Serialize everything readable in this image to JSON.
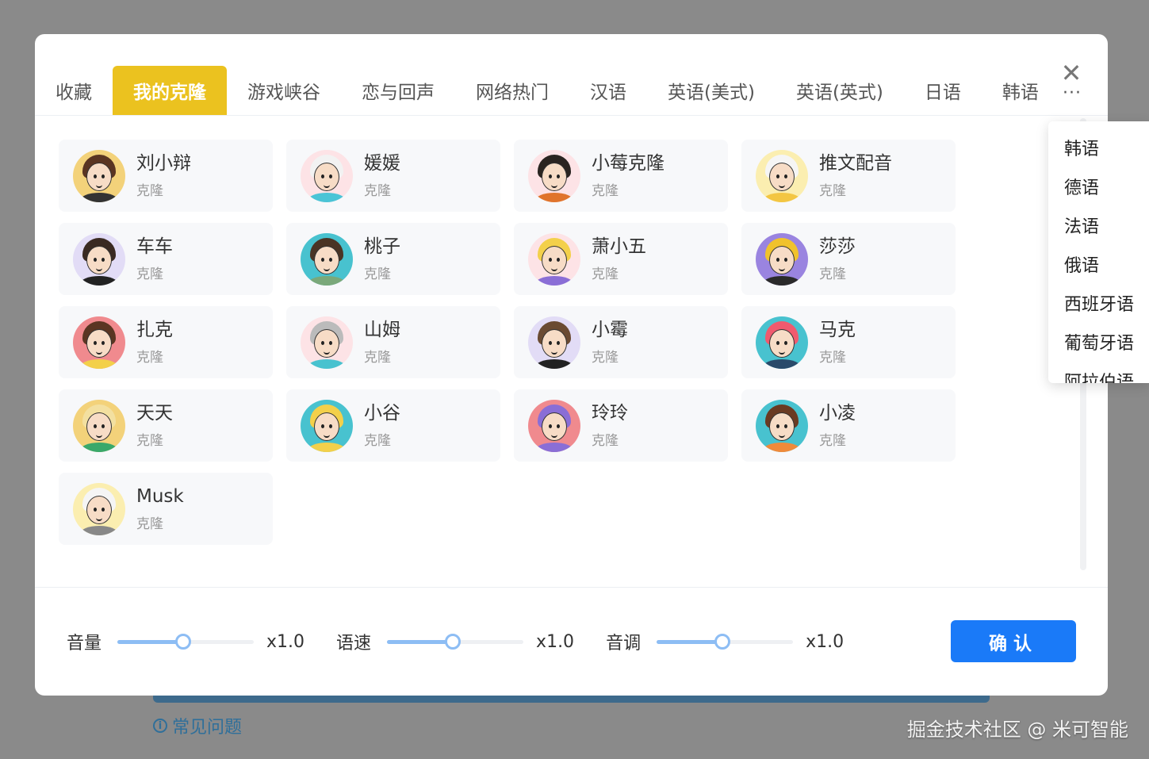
{
  "background": {
    "faq_label": "常见问题",
    "faq_icon": "info-circle-icon",
    "watermark": "掘金技术社区 @ 米可智能"
  },
  "tabs": [
    {
      "label": "收藏",
      "active": false
    },
    {
      "label": "我的克隆",
      "active": true
    },
    {
      "label": "游戏峡谷",
      "active": false
    },
    {
      "label": "恋与回声",
      "active": false
    },
    {
      "label": "网络热门",
      "active": false
    },
    {
      "label": "汉语",
      "active": false
    },
    {
      "label": "英语(美式)",
      "active": false
    },
    {
      "label": "英语(英式)",
      "active": false
    },
    {
      "label": "日语",
      "active": false
    },
    {
      "label": "韩语",
      "active": false
    }
  ],
  "close_icon": "close-icon",
  "more_label": "···",
  "voices": [
    {
      "name": "刘小辩",
      "sub": "克隆",
      "bg": "#f3d27a",
      "hair": "#5a3522",
      "body": "#333333"
    },
    {
      "name": "媛媛",
      "sub": "克隆",
      "bg": "#fde3e6",
      "hair": "#f2f2f2",
      "body": "#4bc4d6"
    },
    {
      "name": "小莓克隆",
      "sub": "克隆",
      "bg": "#fde3e6",
      "hair": "#2a2420",
      "body": "#e0742c"
    },
    {
      "name": "推文配音",
      "sub": "克隆",
      "bg": "#fbeeb0",
      "hair": "#f5f5f5",
      "body": "#f3c643"
    },
    {
      "name": "车车",
      "sub": "克隆",
      "bg": "#e2dcf6",
      "hair": "#3a2a22",
      "body": "#222222"
    },
    {
      "name": "桃子",
      "sub": "克隆",
      "bg": "#48c2cf",
      "hair": "#4a3424",
      "body": "#7aa87a"
    },
    {
      "name": "萧小五",
      "sub": "克隆",
      "bg": "#fde3e6",
      "hair": "#f3d04a",
      "body": "#8a6ed6"
    },
    {
      "name": "莎莎",
      "sub": "克隆",
      "bg": "#9a84e0",
      "hair": "#f0c22c",
      "body": "#2a2a2a"
    },
    {
      "name": "扎克",
      "sub": "克隆",
      "bg": "#f08a8e",
      "hair": "#5a3522",
      "body": "#f3d04a"
    },
    {
      "name": "山姆",
      "sub": "克隆",
      "bg": "#fde3e6",
      "hair": "#bbbbbb",
      "body": "#48c2cf"
    },
    {
      "name": "小霉",
      "sub": "克隆",
      "bg": "#e2dcf6",
      "hair": "#6a4a32",
      "body": "#222222"
    },
    {
      "name": "马克",
      "sub": "克隆",
      "bg": "#48c2cf",
      "hair": "#f05a6e",
      "body": "#2a4a6a"
    },
    {
      "name": "天天",
      "sub": "克隆",
      "bg": "#f3d27a",
      "hair": "#f3e0a0",
      "body": "#3aa86a"
    },
    {
      "name": "小谷",
      "sub": "克隆",
      "bg": "#48c2cf",
      "hair": "#f3d04a",
      "body": "#f3d04a"
    },
    {
      "name": "玲玲",
      "sub": "克隆",
      "bg": "#f08a8e",
      "hair": "#8a6ed6",
      "body": "#8a6ed6"
    },
    {
      "name": "小凌",
      "sub": "克隆",
      "bg": "#48c2cf",
      "hair": "#6a3a22",
      "body": "#f08a3a"
    },
    {
      "name": "Musk",
      "sub": "克隆",
      "bg": "#fbeeb0",
      "hair": "#f5f5f5",
      "body": "#888888"
    }
  ],
  "controls": [
    {
      "label": "音量",
      "value": "x1.0",
      "level": 0.48
    },
    {
      "label": "语速",
      "value": "x1.0",
      "level": 0.48
    },
    {
      "label": "音调",
      "value": "x1.0",
      "level": 0.48
    }
  ],
  "confirm_label": "确认",
  "dropdown": [
    "韩语",
    "德语",
    "法语",
    "俄语",
    "西班牙语",
    "葡萄牙语",
    "阿拉伯语"
  ],
  "colors": {
    "active_tab": "#ebc21f",
    "primary": "#1a7af8",
    "slider": "#8dbdf4"
  }
}
